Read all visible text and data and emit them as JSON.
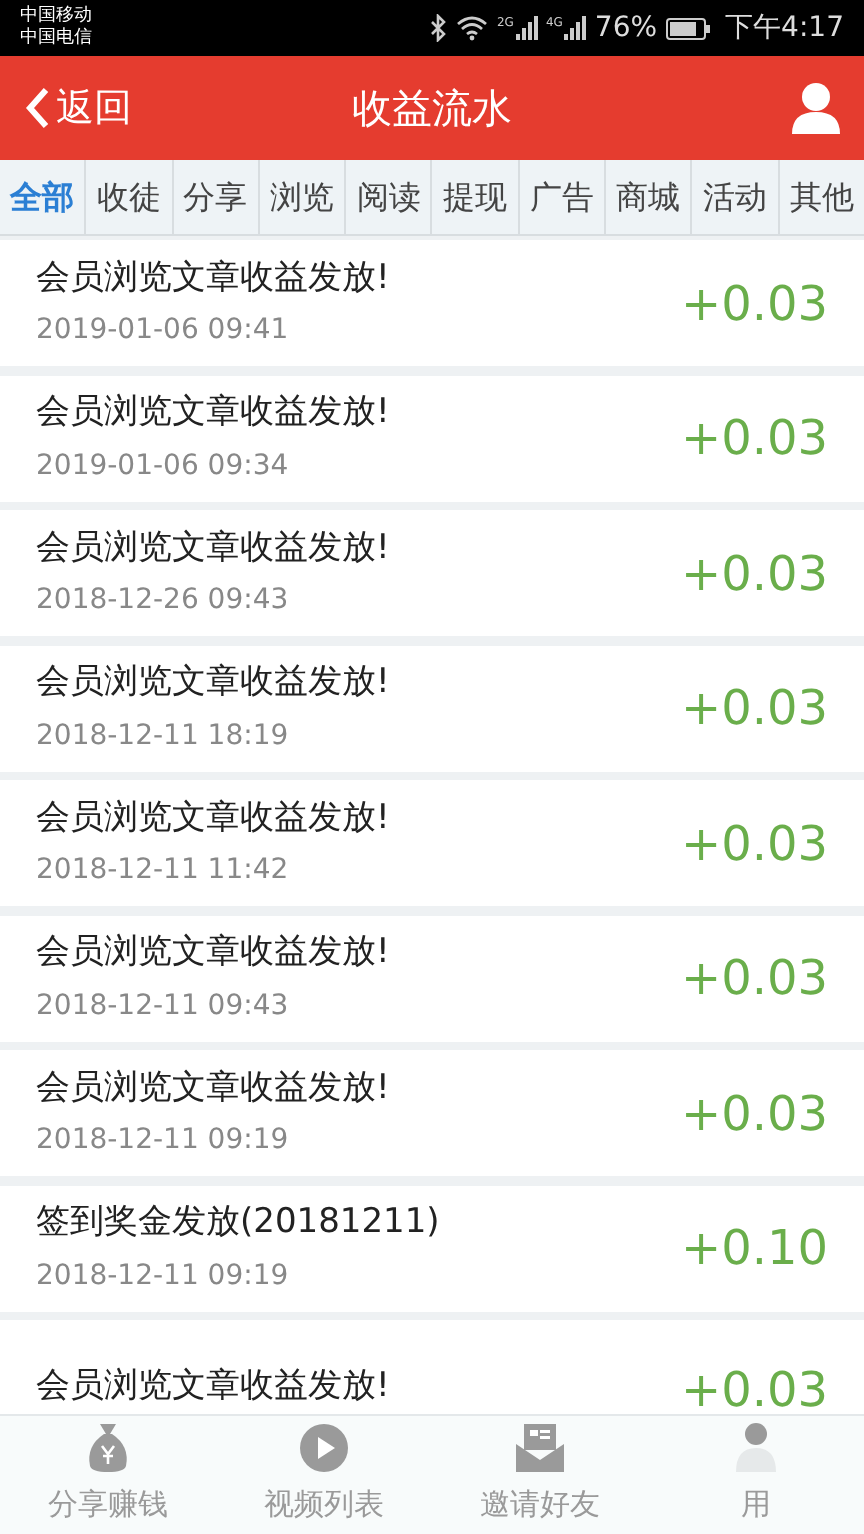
{
  "status_bar": {
    "carriers": [
      "中国移动",
      "中国电信"
    ],
    "network_1": "2G",
    "network_2": "4G",
    "battery": "76%",
    "time": "下午4:17"
  },
  "header": {
    "back": "返回",
    "title": "收益流水"
  },
  "tabs": [
    {
      "label": "全部",
      "selected": true
    },
    {
      "label": "收徒",
      "selected": false
    },
    {
      "label": "分享",
      "selected": false
    },
    {
      "label": "浏览",
      "selected": false
    },
    {
      "label": "阅读",
      "selected": false
    },
    {
      "label": "提现",
      "selected": false
    },
    {
      "label": "广告",
      "selected": false
    },
    {
      "label": "商城",
      "selected": false
    },
    {
      "label": "活动",
      "selected": false
    },
    {
      "label": "其他",
      "selected": false
    }
  ],
  "records": [
    {
      "title": "会员浏览文章收益发放!",
      "time": "2019-01-06 09:41",
      "amount": "+0.03"
    },
    {
      "title": "会员浏览文章收益发放!",
      "time": "2019-01-06 09:34",
      "amount": "+0.03"
    },
    {
      "title": "会员浏览文章收益发放!",
      "time": "2018-12-26 09:43",
      "amount": "+0.03"
    },
    {
      "title": "会员浏览文章收益发放!",
      "time": "2018-12-11 18:19",
      "amount": "+0.03"
    },
    {
      "title": "会员浏览文章收益发放!",
      "time": "2018-12-11 11:42",
      "amount": "+0.03"
    },
    {
      "title": "会员浏览文章收益发放!",
      "time": "2018-12-11 09:43",
      "amount": "+0.03"
    },
    {
      "title": "会员浏览文章收益发放!",
      "time": "2018-12-11 09:19",
      "amount": "+0.03"
    },
    {
      "title": "签到奖金发放(20181211)",
      "time": "2018-12-11 09:19",
      "amount": "+0.10"
    },
    {
      "title": "会员浏览文章收益发放!",
      "amount": "+0.03"
    }
  ],
  "bottom_nav": [
    {
      "kind": "money",
      "label": "分享赚钱"
    },
    {
      "kind": "video",
      "label": "视频列表"
    },
    {
      "kind": "invite",
      "label": "邀请好友"
    },
    {
      "kind": "user",
      "label": "用"
    }
  ]
}
